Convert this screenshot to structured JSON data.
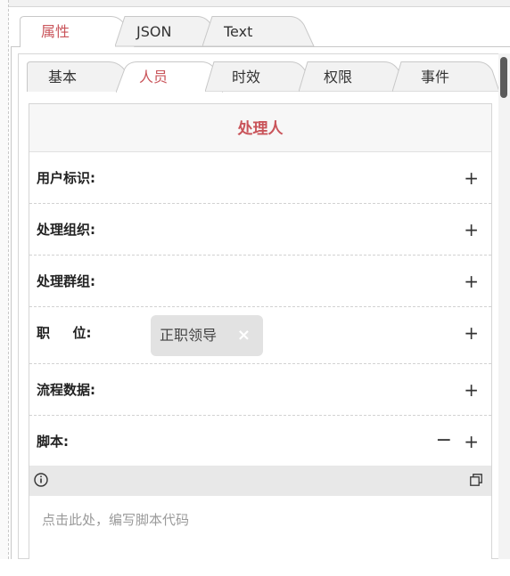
{
  "outer_tabs": [
    {
      "label": "属性",
      "active": true
    },
    {
      "label": "JSON",
      "active": false
    },
    {
      "label": "Text",
      "active": false
    }
  ],
  "inner_tabs": [
    {
      "label": "基本",
      "active": false
    },
    {
      "label": "人员",
      "active": true
    },
    {
      "label": "时效",
      "active": false
    },
    {
      "label": "权限",
      "active": false
    },
    {
      "label": "事件",
      "active": false
    }
  ],
  "panel": {
    "title": "处理人",
    "rows": [
      {
        "label": "用户标识:",
        "add": "+"
      },
      {
        "label": "处理组织:",
        "add": "+"
      },
      {
        "label": "处理群组:",
        "add": "+"
      },
      {
        "label": "职　  位:",
        "add": "+",
        "chip": "正职领导",
        "chip_remove": "×"
      },
      {
        "label": "流程数据:",
        "add": "+"
      },
      {
        "label": "脚本:",
        "add": "+",
        "remove": "−"
      }
    ]
  },
  "editor": {
    "placeholder": "点击此处，编写脚本代码",
    "info_icon": "info-icon",
    "maximize_icon": "maximize-icon"
  },
  "colors": {
    "accent": "#c9545a",
    "text": "#333333",
    "border": "#d5d5d5"
  }
}
